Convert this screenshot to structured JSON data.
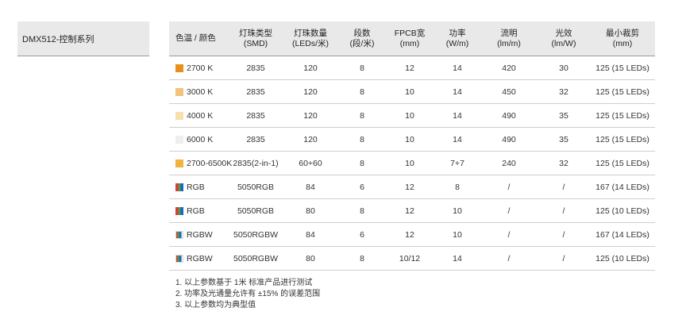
{
  "sidebar": {
    "title": "DMX512-控制系列"
  },
  "table": {
    "headers": [
      [
        "色温 / 颜色",
        ""
      ],
      [
        "灯珠类型",
        "(SMD)"
      ],
      [
        "灯珠数量",
        "(LEDs/米)"
      ],
      [
        "段数",
        "(段/米)"
      ],
      [
        "FPCB宽",
        "(mm)"
      ],
      [
        "功率",
        "(W/m)"
      ],
      [
        "流明",
        "(lm/m)"
      ],
      [
        "光效",
        "(lm/W)"
      ],
      [
        "最小裁剪",
        "(mm)"
      ]
    ],
    "rows": [
      {
        "swatch": "#e8901c",
        "swatch_type": "solid",
        "cells": [
          "2700 K",
          "2835",
          "120",
          "8",
          "12",
          "14",
          "420",
          "30",
          "125 (15 LEDs)"
        ]
      },
      {
        "swatch": "#f2c27e",
        "swatch_type": "solid",
        "cells": [
          "3000 K",
          "2835",
          "120",
          "8",
          "10",
          "14",
          "450",
          "32",
          "125 (15 LEDs)"
        ]
      },
      {
        "swatch": "#f7dfae",
        "swatch_type": "solid",
        "cells": [
          "4000 K",
          "2835",
          "120",
          "8",
          "10",
          "14",
          "490",
          "35",
          "125 (15 LEDs)"
        ]
      },
      {
        "swatch": "#eeeeee",
        "swatch_type": "solid",
        "cells": [
          "6000 K",
          "2835",
          "120",
          "8",
          "10",
          "14",
          "490",
          "35",
          "125 (15 LEDs)"
        ]
      },
      {
        "swatch": "#f0b43c",
        "swatch_type": "solid",
        "cells": [
          "2700-6500K",
          "2835(2-in-1)",
          "60+60",
          "8",
          "10",
          "7+7",
          "240",
          "32",
          "125 (15 LEDs)"
        ]
      },
      {
        "swatch": "",
        "swatch_type": "rgb",
        "cells": [
          "RGB",
          "5050RGB",
          "84",
          "6",
          "12",
          "8",
          "/",
          "/",
          "167 (14 LEDs)"
        ]
      },
      {
        "swatch": "",
        "swatch_type": "rgb",
        "cells": [
          "RGB",
          "5050RGB",
          "80",
          "8",
          "12",
          "10",
          "/",
          "/",
          "125 (10 LEDs)"
        ]
      },
      {
        "swatch": "",
        "swatch_type": "rgbw",
        "cells": [
          "RGBW",
          "5050RGBW",
          "84",
          "6",
          "12",
          "10",
          "/",
          "/",
          "167 (14 LEDs)"
        ]
      },
      {
        "swatch": "",
        "swatch_type": "rgbw",
        "cells": [
          "RGBW",
          "5050RGBW",
          "80",
          "8",
          "10/12",
          "14",
          "/",
          "/",
          "125 (10 LEDs)"
        ]
      }
    ]
  },
  "notes": [
    "1. 以上参数基于 1米 标准产品进行测试",
    "2. 功率及光通量允许有 ±15% 的误差范围",
    "3. 以上参数均为典型值"
  ]
}
